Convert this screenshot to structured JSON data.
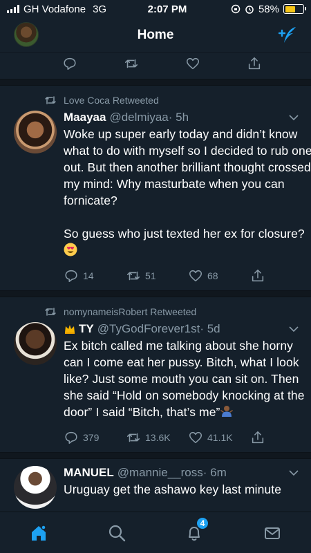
{
  "status_bar": {
    "carrier": "GH Vodafone",
    "network": "3G",
    "time": "2:07 PM",
    "battery_percent": "58%",
    "battery_level": 0.58,
    "battery_color": "#f5c518"
  },
  "nav": {
    "title": "Home"
  },
  "top_tweet_actions": {
    "icons": [
      "reply-icon",
      "retweet-icon",
      "like-icon",
      "share-icon"
    ]
  },
  "tweets": [
    {
      "retweeted_by": "Love Coca Retweeted",
      "name": "Maayaa",
      "handle": "@delmiyaa",
      "time": "· 5h",
      "text": "Woke up super early today and didn’t know what to do with myself so I decided to rub one out. But then another brilliant thought crossed my mind: Why masturbate when you can fornicate?\n\nSo guess who just texted her ex for closure?",
      "emoji": "heart-eyes",
      "replies": "14",
      "retweets": "51",
      "likes": "68"
    },
    {
      "retweeted_by": "nomynameisRobert Retweeted",
      "name": "TY",
      "handle": "@TyGodForever1st",
      "time": "· 5d",
      "text": "Ex bitch called me talking about she horny can I come eat her pussy. Bitch, what I look like? Just some mouth you can sit on. Then she said “Hold on somebody knocking at the door” I said “Bitch, that’s me”",
      "emoji": "shrug",
      "replies": "379",
      "retweets": "13.6K",
      "likes": "41.1K"
    },
    {
      "name": "MANUEL",
      "handle": "@mannie__ross",
      "time": "· 6m",
      "text": "Uruguay get the ashawo key last minute"
    }
  ],
  "tab_bar": {
    "notifications_badge": "4",
    "accent_color": "#1da1f2"
  }
}
